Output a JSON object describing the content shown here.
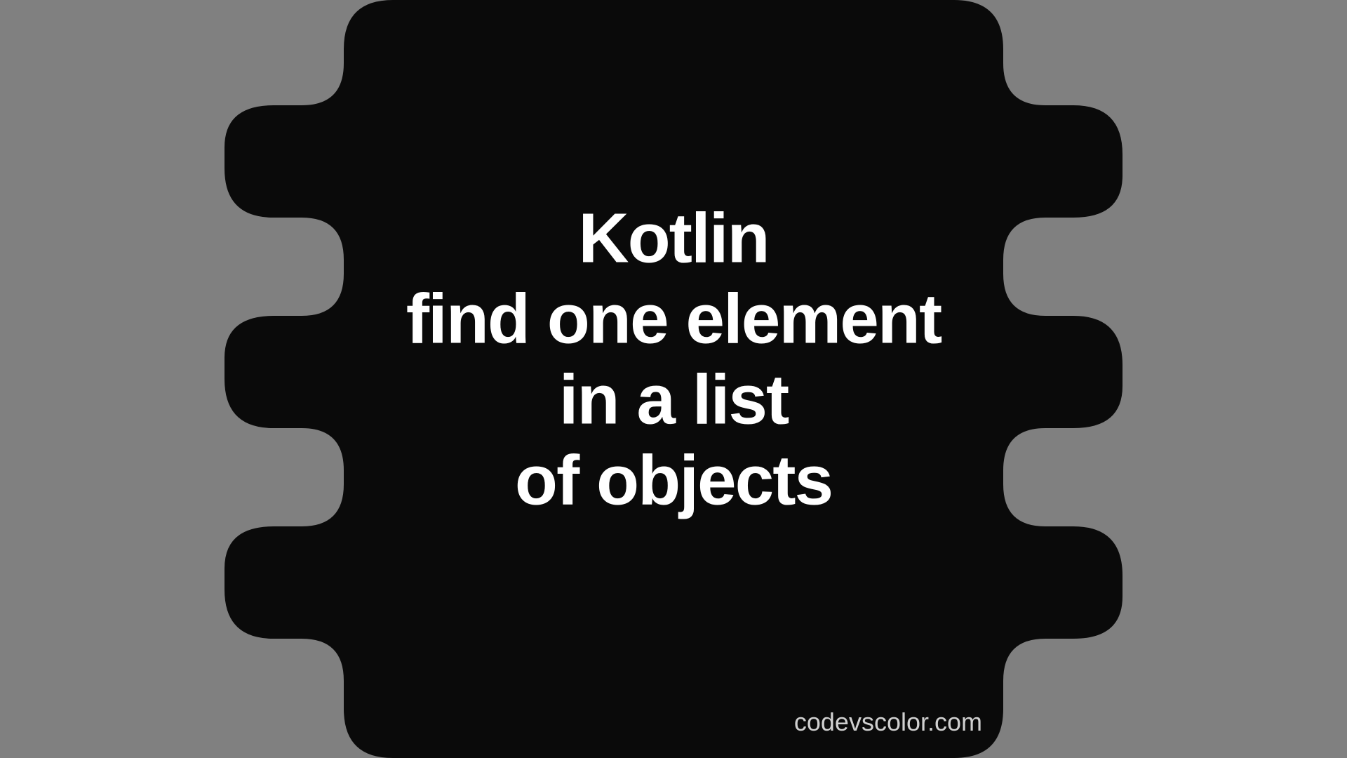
{
  "title": {
    "line1": "Kotlin",
    "line2": "find one element",
    "line3": "in a list",
    "line4": "of objects"
  },
  "watermark": "codevscolor.com",
  "colors": {
    "background": "#808080",
    "blob": "#0a0a0a",
    "text": "#ffffff",
    "watermark": "#d0d0d0"
  }
}
